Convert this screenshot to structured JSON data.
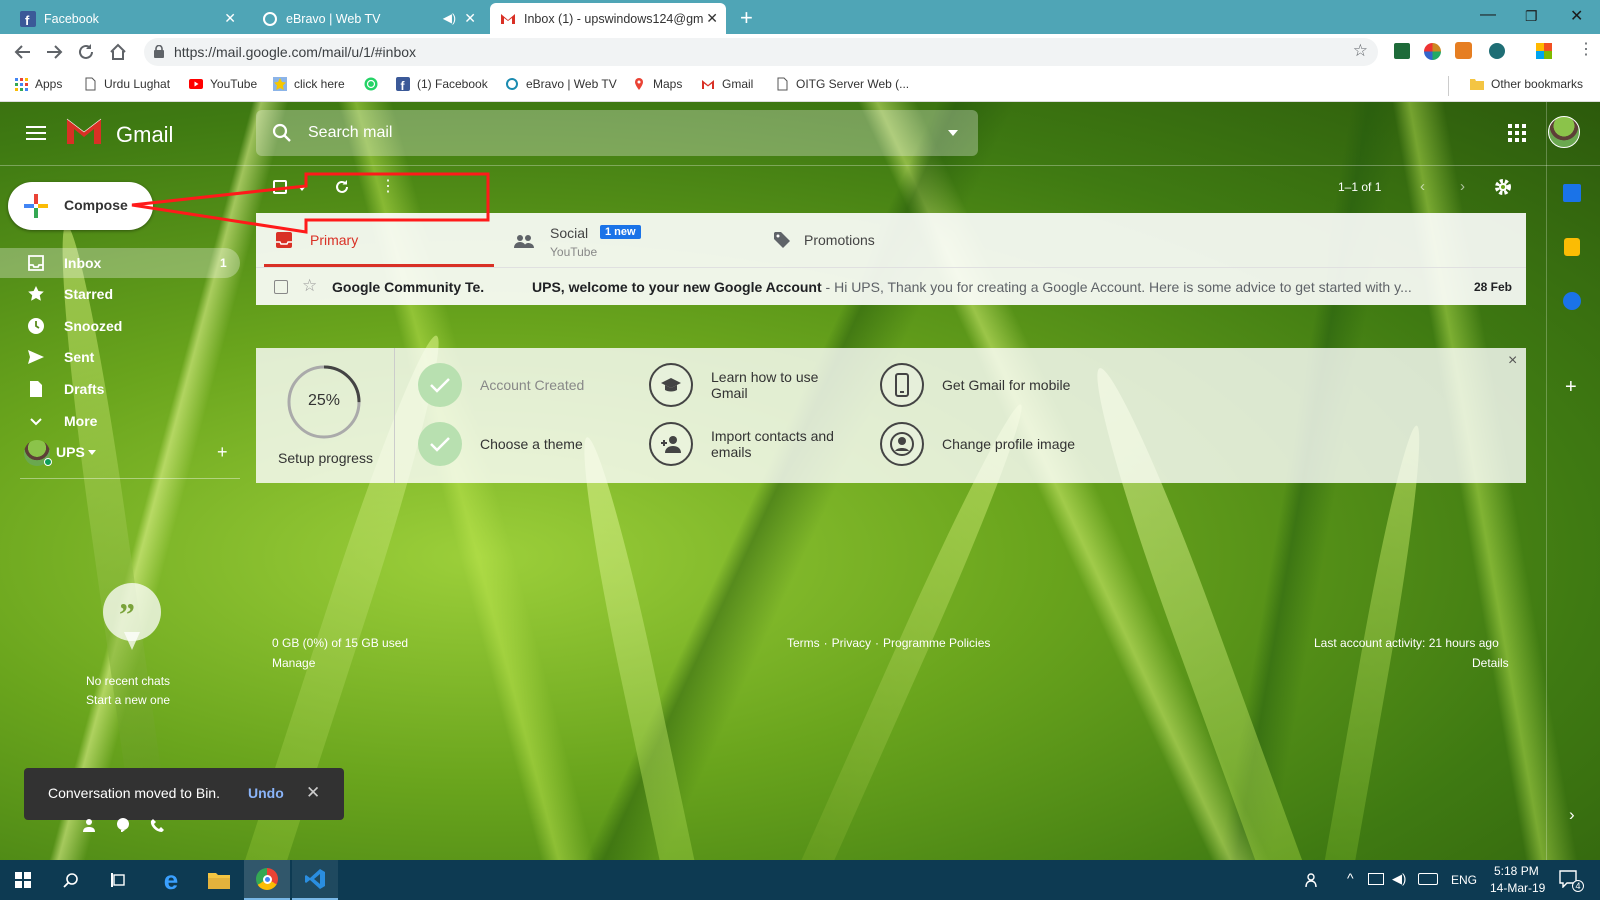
{
  "browser": {
    "tabs": [
      {
        "title": "Facebook"
      },
      {
        "title": "eBravo | Web TV"
      },
      {
        "title": "Inbox (1) - upswindows124@gm"
      }
    ],
    "new_tab_symbol": "+",
    "url": "https://mail.google.com/mail/u/1/#inbox"
  },
  "bookmarks": {
    "items": [
      "Apps",
      "Urdu Lughat",
      "YouTube",
      "click here",
      "(1) Facebook",
      "eBravo | Web TV",
      "Maps",
      "Gmail",
      "OITG Server Web (..."
    ],
    "other": "Other bookmarks"
  },
  "gmail": {
    "logo_text": "Gmail",
    "search_placeholder": "Search mail",
    "compose_label": "Compose",
    "nav": [
      {
        "label": "Inbox",
        "count": "1",
        "icon": "inbox-icon"
      },
      {
        "label": "Starred",
        "count": "",
        "icon": "star-icon"
      },
      {
        "label": "Snoozed",
        "count": "",
        "icon": "clock-icon"
      },
      {
        "label": "Sent",
        "count": "",
        "icon": "send-icon"
      },
      {
        "label": "Drafts",
        "count": "",
        "icon": "draft-icon"
      },
      {
        "label": "More",
        "count": "",
        "icon": "chevron-down-icon"
      }
    ],
    "account_label": "UPS",
    "pagination": "1–1 of 1",
    "tabs": {
      "primary": "Primary",
      "social": "Social",
      "social_badge": "1 new",
      "social_sub": "YouTube",
      "promotions": "Promotions"
    },
    "emails": [
      {
        "sender": "Google Community Te.",
        "subject": "UPS, welcome to your new Google Account",
        "snippet": " - Hi UPS, Thank you for creating a Google Account. Here is some advice to get started with y...",
        "date": "28 Feb"
      }
    ],
    "setup": {
      "progress": 0.25,
      "progress_text": "25%",
      "label": "Setup progress",
      "steps": [
        {
          "label": "Account Created",
          "done": true
        },
        {
          "label": "Choose a theme",
          "done": true
        },
        {
          "label": "Learn how to use Gmail",
          "done": false
        },
        {
          "label": "Import contacts and emails",
          "done": false
        },
        {
          "label": "Get Gmail for mobile",
          "done": false
        },
        {
          "label": "Change profile image",
          "done": false
        }
      ],
      "close_symbol": "×"
    },
    "footer": {
      "storage": "0 GB (0%) of 15 GB used",
      "manage": "Manage",
      "terms": "Terms",
      "privacy": "Privacy",
      "policies": "Programme Policies",
      "sep": "·",
      "activity": "Last account activity: 21 hours ago",
      "details": "Details"
    },
    "chat": {
      "line1": "No recent chats",
      "line2": "Start a new one"
    },
    "snackbar": {
      "message": "Conversation moved to Bin.",
      "action": "Undo"
    }
  },
  "taskbar": {
    "lang": "ENG",
    "time": "5:18 PM",
    "date": "14-Mar-19",
    "notif_count": "4"
  },
  "colors": {
    "tabstrip": "#4fa5b6",
    "gmail_red": "#d93025",
    "annotation_red": "#ff1a1a",
    "badge_blue": "#1a73e8",
    "taskbar": "#0d3a52"
  }
}
